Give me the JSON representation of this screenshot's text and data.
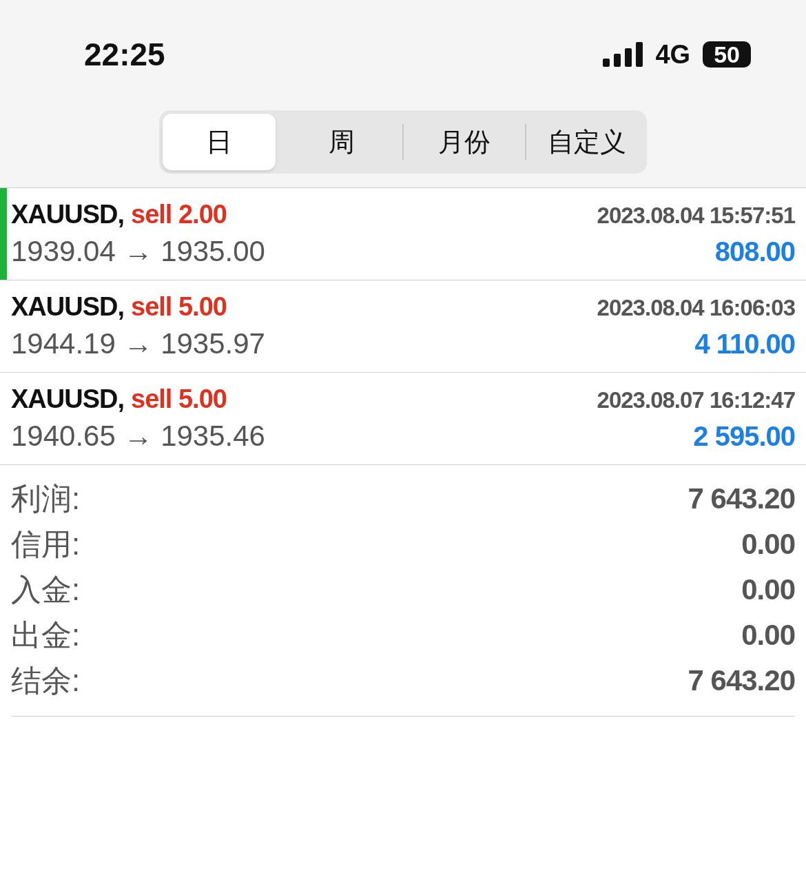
{
  "status_bar": {
    "time": "22:25",
    "network": "4G",
    "battery": "50"
  },
  "tabs": [
    {
      "label": "日",
      "selected": true
    },
    {
      "label": "周",
      "selected": false
    },
    {
      "label": "月份",
      "selected": false
    },
    {
      "label": "自定义",
      "selected": false
    }
  ],
  "deals": [
    {
      "symbol": "XAUUSD,",
      "side": "sell 2.00",
      "time": "2023.08.04 15:57:51",
      "prices": "1939.04 → 1935.00",
      "profit": "808.00",
      "selected": true
    },
    {
      "symbol": "XAUUSD,",
      "side": "sell 5.00",
      "time": "2023.08.04 16:06:03",
      "prices": "1944.19 → 1935.97",
      "profit": "4 110.00",
      "selected": false
    },
    {
      "symbol": "XAUUSD,",
      "side": "sell 5.00",
      "time": "2023.08.07 16:12:47",
      "prices": "1940.65 → 1935.46",
      "profit": "2 595.00",
      "selected": false
    }
  ],
  "summary": [
    {
      "label": "利润:",
      "value": "7 643.20"
    },
    {
      "label": "信用:",
      "value": "0.00"
    },
    {
      "label": "入金:",
      "value": "0.00"
    },
    {
      "label": "出金:",
      "value": "0.00"
    },
    {
      "label": "结余:",
      "value": "7 643.20"
    }
  ]
}
